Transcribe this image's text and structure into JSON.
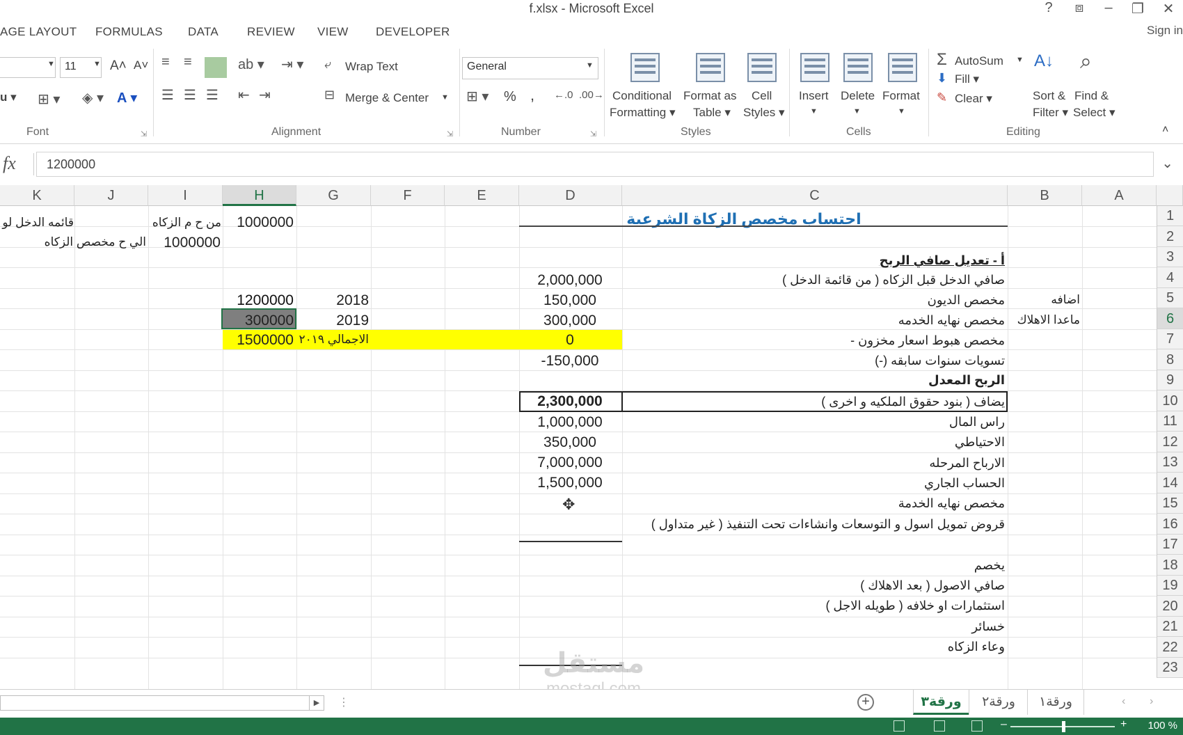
{
  "window": {
    "title": "f.xlsx - Microsoft Excel",
    "help": "?",
    "minimize": "–",
    "close": "✕",
    "sign_in": "Sign in"
  },
  "tabs": [
    "AGE LAYOUT",
    "FORMULAS",
    "DATA",
    "REVIEW",
    "VIEW",
    "DEVELOPER"
  ],
  "ribbon": {
    "font": {
      "name_value": "",
      "size_value": "11",
      "grow": "A˄",
      "shrink": "A˅",
      "group": "Font"
    },
    "alignment": {
      "wrap_text": "Wrap Text",
      "merge_center": "Merge & Center",
      "group": "Alignment"
    },
    "number": {
      "format_value": "General",
      "percent": "%",
      "comma": ",",
      "group": "Number"
    },
    "styles": {
      "conditional_1": "Conditional",
      "conditional_2": "Formatting ▾",
      "format_table_1": "Format as",
      "format_table_2": "Table ▾",
      "cell_styles_1": "Cell",
      "cell_styles_2": "Styles ▾",
      "group": "Styles"
    },
    "cells": {
      "insert": "Insert",
      "delete": "Delete",
      "format": "Format",
      "group": "Cells"
    },
    "editing": {
      "autosum": "AutoSum",
      "fill": "Fill ▾",
      "clear": "Clear ▾",
      "sort_1": "Sort &",
      "sort_2": "Filter ▾",
      "find_1": "Find &",
      "find_2": "Select ▾",
      "group": "Editing"
    }
  },
  "formula_bar": {
    "fx": "fx",
    "value": "1200000"
  },
  "columns": [
    "K",
    "J",
    "I",
    "H",
    "G",
    "F",
    "E",
    "D",
    "C",
    "B",
    "A"
  ],
  "selected_column": "H",
  "rows": [
    "1",
    "2",
    "3",
    "4",
    "5",
    "6",
    "7",
    "8",
    "9",
    "10",
    "11",
    "12",
    "13",
    "14",
    "15",
    "16",
    "17",
    "18",
    "19",
    "20",
    "21",
    "22",
    "23"
  ],
  "selected_row": "6",
  "cells": {
    "C2": "احتساب مخصص الزكاة الشرعية",
    "H2": "1000000",
    "I2": "من ح م الزكاه",
    "K2": "قائمه الدخل لو",
    "I3": "1000000",
    "K3": "الي ح مخصص الزكاه",
    "C4": "أ - تعديل صافي الربح",
    "C5": "صافي الدخل قبل الزكاه ( من قائمة الدخل )",
    "D5": "2,000,000",
    "B6": "اضافه",
    "C6": "مخصص الديون",
    "D6": "150,000",
    "G6": "2018",
    "H6": "1200000",
    "B7": "ماعدا الاهلاك",
    "C7": "مخصص نهايه الخدمه",
    "D7": "300,000",
    "G7": "2019",
    "H7": "300000",
    "C8": "مخصص هبوط اسعار مخزون -",
    "D8": "0",
    "G8": "الاجمالي ٢٠١٩",
    "H8": "1500000",
    "C9": "تسويات سنوات سابقه (-)",
    "D9": "-150,000",
    "C10": "الربح المعدل",
    "D10": "2,300,000",
    "C11": "يضاف ( بنود حقوق الملكيه و اخرى )",
    "C12": "راس المال",
    "D12": "1,000,000",
    "C13": "الاحتياطي",
    "D13": "350,000",
    "C14": "الارباح المرحله",
    "D14": "7,000,000",
    "C15": "الحساب الجاري",
    "D15": "1,500,000",
    "C16": "مخصص نهايه الخدمة",
    "C17": "قروض تمويل اسول و التوسعات وانشاءات تحت التنفيذ ( غير متداول )",
    "C19": "يخصم",
    "C20": "صافي الاصول ( بعد الاهلاك )",
    "C21": "استثمارات او خلافه ( طويله الاجل )",
    "C22": "خسائر",
    "C23": "وعاء الزكاه"
  },
  "sheet_tabs": [
    "ورقة٣",
    "ورقة٢",
    "ورقة١"
  ],
  "active_sheet": "ورقة٣",
  "status": {
    "zoom": "100 %"
  },
  "watermark": {
    "logo": "مستقل",
    "site": "mostaql.com"
  },
  "colors": {
    "excel_green": "#217346",
    "highlight_yellow": "#ffff00",
    "title_blue": "#1f6fb3"
  }
}
